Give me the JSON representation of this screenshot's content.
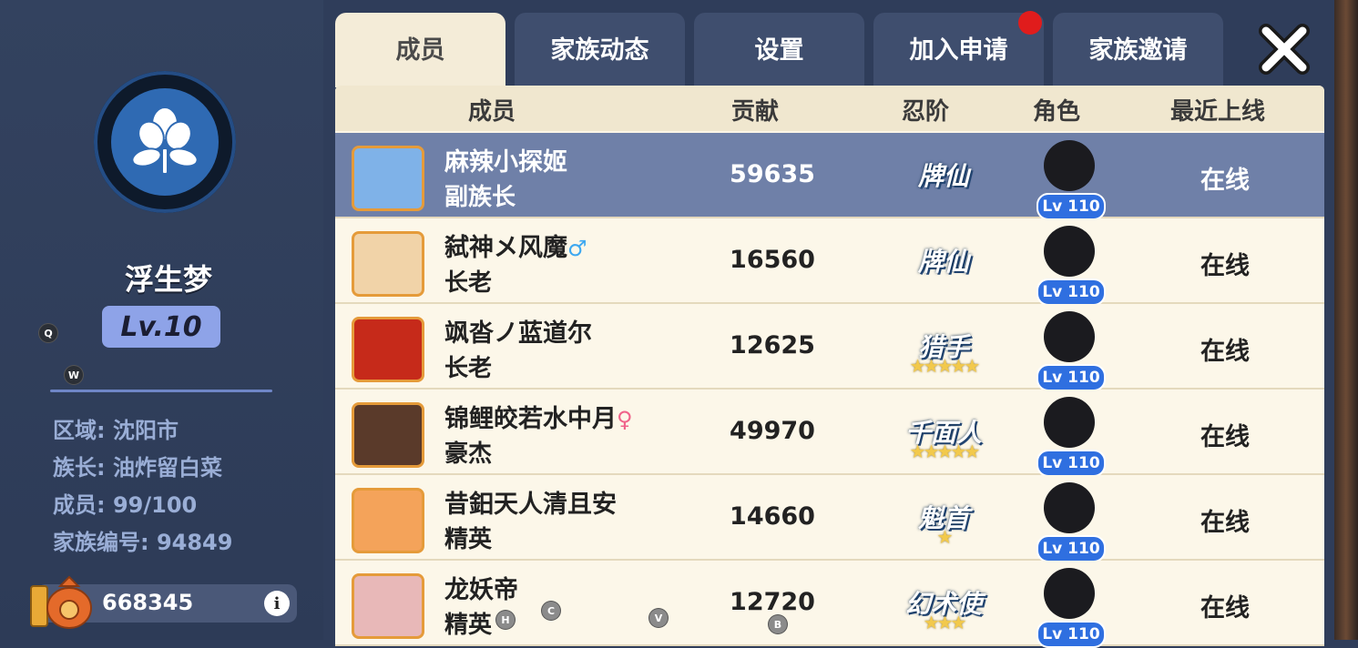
{
  "family": {
    "name": "浮生梦",
    "level": "Lv.10",
    "region": "区域: 沈阳市",
    "leader": "族长: 油炸留白菜",
    "members": "成员: 99/100",
    "family_id": "家族编号: 94849",
    "coins": "668345"
  },
  "hotkeys": {
    "q": "Q",
    "w": "W",
    "h": "H",
    "c": "C",
    "v": "V",
    "b": "B"
  },
  "tabs": [
    "成员",
    "家族动态",
    "设置",
    "加入申请",
    "家族邀请"
  ],
  "columns": [
    "成员",
    "贡献",
    "忍阶",
    "角色",
    "最近上线"
  ],
  "rows": [
    {
      "name": "麻辣小探姬",
      "gender": "",
      "rank": "副族长",
      "contribution": "59635",
      "title": "牌仙",
      "stars": "",
      "level": "Lv 110",
      "status": "在线"
    },
    {
      "name": "弑神メ风魔",
      "gender": "♂",
      "rank": "长老",
      "contribution": "16560",
      "title": "牌仙",
      "stars": "",
      "level": "Lv 110",
      "status": "在线"
    },
    {
      "name": "飒沓ノ蓝道尔",
      "gender": "",
      "rank": "长老",
      "contribution": "12625",
      "title": "猎手",
      "stars": "★★★★★",
      "level": "Lv 110",
      "status": "在线"
    },
    {
      "name": "锦鲤皎若水中月",
      "gender": "♀",
      "rank": "豪杰",
      "contribution": "49970",
      "title": "千面人",
      "stars": "★★★★★",
      "level": "Lv 110",
      "status": "在线"
    },
    {
      "name": "昔鈤天人清且安",
      "gender": "",
      "rank": "精英",
      "contribution": "14660",
      "title": "魁首",
      "stars": "★",
      "level": "Lv 110",
      "status": "在线"
    },
    {
      "name": "龙妖帝",
      "gender": "",
      "rank": "精英",
      "contribution": "12720",
      "title": "幻术使",
      "stars": "★★★",
      "level": "Lv 110",
      "status": "在线"
    }
  ],
  "colors": {
    "selected_row": "#6f80a8",
    "active_tab": "#f4ecd8",
    "level_badge": "#8ea3e8"
  }
}
